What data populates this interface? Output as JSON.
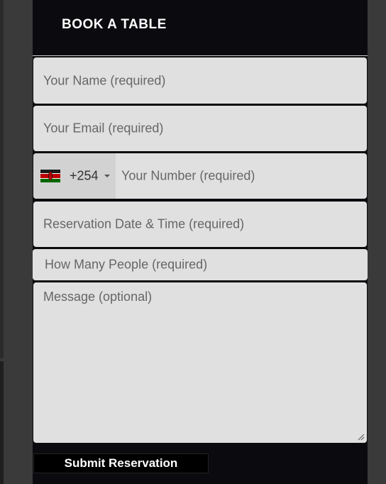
{
  "header": {
    "title": "BOOK A TABLE"
  },
  "form": {
    "name": {
      "placeholder": "Your Name (required)",
      "value": ""
    },
    "email": {
      "placeholder": "Your Email (required)",
      "value": ""
    },
    "phone": {
      "country_flag": "kenya-flag-icon",
      "dial_code": "+254",
      "placeholder": "Your Number (required)",
      "value": ""
    },
    "datetime": {
      "placeholder": "Reservation Date & Time (required)",
      "value": ""
    },
    "people": {
      "placeholder": "How Many People (required)",
      "value": ""
    },
    "message": {
      "placeholder": "Message (optional)",
      "value": ""
    },
    "submit_label": "Submit Reservation"
  },
  "colors": {
    "panel_bg": "#0b0b0f",
    "field_bg": "#e0e0e0",
    "placeholder_text": "#666666",
    "button_bg": "#000000",
    "button_text": "#ffffff"
  }
}
